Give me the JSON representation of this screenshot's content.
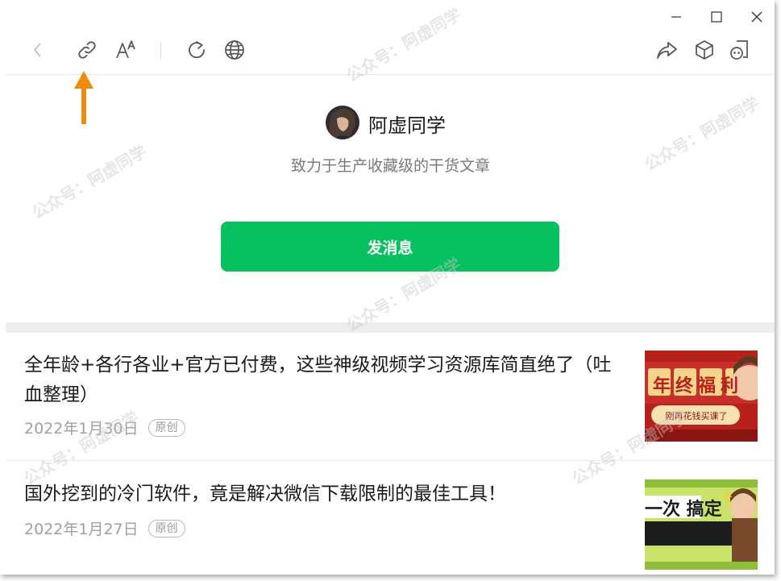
{
  "window": {
    "controls": {
      "minimize_icon": "minimize-icon",
      "maximize_icon": "maximize-icon",
      "close_icon": "close-icon"
    }
  },
  "toolbar": {
    "left": [
      "back-icon",
      "link-icon",
      "font-size-icon",
      "refresh-icon",
      "globe-icon"
    ],
    "right": [
      "share-icon",
      "cube-icon",
      "mini-program-icon"
    ]
  },
  "annotation": {
    "color": "#f08a0f"
  },
  "profile": {
    "name": "阿虚同学",
    "description": "致力于生产收藏级的干货文章",
    "send_button": "发消息"
  },
  "articles": [
    {
      "title": "全年龄+各行各业+官方已付费，这些神级视频学习资源库简直绝了（吐血整理）",
      "date": "2022年1月30日",
      "badge": "原创",
      "thumb_text": "年终福利",
      "thumb_sub": "刚再花钱买课了"
    },
    {
      "title": "国外挖到的冷门软件，竟是解决微信下载限制的最佳工具！",
      "date": "2022年1月27日",
      "badge": "原创",
      "thumb_text": "一次 搞定微信"
    }
  ],
  "watermark": "公众号：阿虚同学",
  "colors": {
    "accent": "#07c160",
    "divider": "#ededed"
  }
}
